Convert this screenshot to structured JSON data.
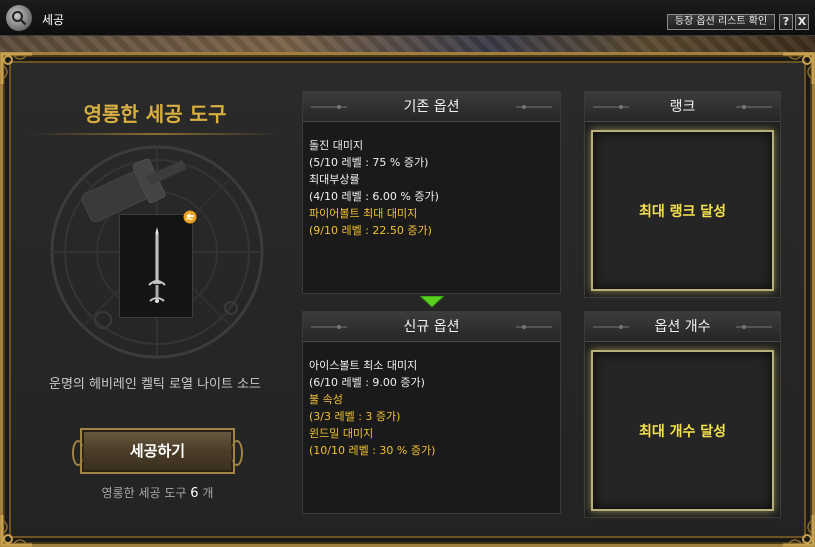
{
  "window": {
    "title": "세공",
    "option_list_button": "등장 옵션 리스트 확인",
    "help_label": "?",
    "close_label": "X"
  },
  "tool": {
    "title": "영롱한 세공 도구",
    "item_name": "운명의 헤비레인 켈틱 로열 나이트 소드",
    "craft_button": "세공하기",
    "count_label": "영롱한 세공 도구",
    "count_value": "6",
    "count_unit": "개"
  },
  "existing_options": {
    "header": "기존 옵션",
    "lines": [
      {
        "text": "돌진 대미지",
        "color": "white"
      },
      {
        "text": "(5/10 레벨 : 75 % 증가)",
        "color": "white"
      },
      {
        "text": "최대부상률",
        "color": "white"
      },
      {
        "text": "(4/10 레벨 : 6.00 % 증가)",
        "color": "white"
      },
      {
        "text": "파이어볼트 최대 대미지",
        "color": "gold"
      },
      {
        "text": "(9/10 레벨 : 22.50 증가)",
        "color": "gold"
      }
    ]
  },
  "new_options": {
    "header": "신규 옵션",
    "lines": [
      {
        "text": "아이스볼트 최소 대미지",
        "color": "white"
      },
      {
        "text": "(6/10 레벨 : 9.00 증가)",
        "color": "white"
      },
      {
        "text": "불 속성",
        "color": "gold"
      },
      {
        "text": "(3/3 레벨 : 3 증가)",
        "color": "gold"
      },
      {
        "text": "윈드밀 대미지",
        "color": "gold"
      },
      {
        "text": "(10/10 레벨 : 30 % 증가)",
        "color": "gold"
      }
    ]
  },
  "rank": {
    "header": "랭크",
    "status": "최대 랭크 달성"
  },
  "option_count": {
    "header": "옵션 개수",
    "status": "최대 개수 달성"
  },
  "colors": {
    "gold_text": "#f0c030",
    "title_gold": "#d9b040",
    "frame_gold": "#a0803c",
    "status_yellow": "#f4e050"
  },
  "icons": {
    "title": "magnifier-icon",
    "item": "sword-icon",
    "swap": "swap-icon",
    "arrow": "arrow-down-icon"
  }
}
